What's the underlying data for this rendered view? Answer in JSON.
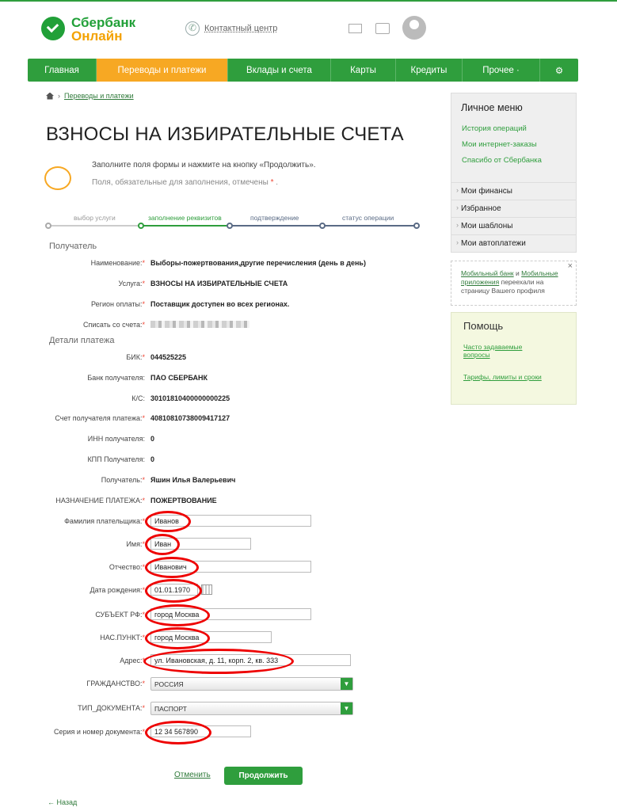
{
  "header": {
    "logo_line1": "Сбербанк",
    "logo_line2": "Онлайн",
    "contact_center": "Контактный центр",
    "icons": [
      "phone-icon",
      "mail-icon",
      "chat-icon",
      "avatar"
    ]
  },
  "nav": {
    "items": [
      "Главная",
      "Переводы и платежи",
      "Вклады и счета",
      "Карты",
      "Кредиты",
      "Прочее ·",
      "⚙"
    ],
    "active_index": 1,
    "colors": {
      "bar": "#2f9e3d",
      "active": "#f7a823"
    }
  },
  "breadcrumb": {
    "link": "Переводы и платежи"
  },
  "page": {
    "title": "ВЗНОСЫ НА ИЗБИРАТЕЛЬНЫЕ СЧЕТА",
    "hint_main": "Заполните поля формы и нажмите на кнопку «Продолжить».",
    "hint_required": "Поля, обязательные для заполнения, отмечены",
    "required_mark": "*"
  },
  "steps": [
    "выбор услуги",
    "заполнение реквизитов",
    "подтверждение",
    "статус операции"
  ],
  "sections": {
    "recipient": "Получатель",
    "details": "Детали платежа"
  },
  "recipient": [
    {
      "label": "Наименование:",
      "required": true,
      "value": "Выборы-пожертвования,другие перечисления (день в день)"
    },
    {
      "label": "Услуга:",
      "required": true,
      "value": "ВЗНОСЫ НА ИЗБИРАТЕЛЬНЫЕ СЧЕТА"
    },
    {
      "label": "Регион оплаты:",
      "required": true,
      "value": "Поставщик доступен во всех регионах."
    },
    {
      "label": "Списать со счета:",
      "required": true,
      "value": ""
    }
  ],
  "details": [
    {
      "label": "БИК:",
      "required": true,
      "value": "044525225"
    },
    {
      "label": "Банк получателя:",
      "required": false,
      "value": "ПАО СБЕРБАНК"
    },
    {
      "label": "К/С:",
      "required": false,
      "value": "30101810400000000225"
    },
    {
      "label": "Счет получателя платежа:",
      "required": true,
      "value": "40810810738009417127"
    },
    {
      "label": "ИНН получателя:",
      "required": false,
      "value": "0"
    },
    {
      "label": "КПП Получателя:",
      "required": false,
      "value": "0"
    },
    {
      "label": "Получатель:",
      "required": true,
      "value": "Яшин Илья Валерьевич"
    },
    {
      "label": "НАЗНАЧЕНИЕ ПЛАТЕЖА:",
      "required": true,
      "value": "ПОЖЕРТВОВАНИЕ"
    }
  ],
  "inputs": [
    {
      "label": "Фамилия плательщика:",
      "value": "Иванов"
    },
    {
      "label": "Имя:",
      "value": "Иван"
    },
    {
      "label": "Отчество:",
      "value": "Иванович"
    },
    {
      "label": "Дата рождения:",
      "value": "01.01.1970"
    },
    {
      "label": "СУБЪЕКТ РФ:",
      "value": "город Москва"
    },
    {
      "label": "НАС.ПУНКТ:",
      "value": "город Москва"
    },
    {
      "label": "Адрес:",
      "value": "ул. Ивановская, д. 11, корп. 2, кв. 333"
    },
    {
      "label": "ГРАЖДАНСТВО:",
      "value": "РОССИЯ"
    },
    {
      "label": "ТИП_ДОКУМЕНТА:",
      "value": "ПАСПОРТ"
    },
    {
      "label": "Серия и номер документа:",
      "value": "12 34 567890"
    }
  ],
  "actions": {
    "cancel": "Отменить",
    "submit": "Продолжить",
    "back": "← Назад"
  },
  "sidebar": {
    "title": "Личное меню",
    "links": [
      "История операций",
      "Мои интернет-заказы",
      "Спасибо от Сбербанка"
    ],
    "items": [
      "Мои финансы",
      "Избранное",
      "Мои шаблоны",
      "Мои автоплатежи"
    ]
  },
  "notice": {
    "link1": "Мобильный банк",
    "and": " и ",
    "link2": "Мобильные приложения",
    "rest": " переехали на страницу Вашего профиля",
    "close": "×"
  },
  "help": {
    "title": "Помощь",
    "faq": "Часто задаваемые вопросы",
    "tariffs": "Тарифы, лимиты и сроки"
  }
}
